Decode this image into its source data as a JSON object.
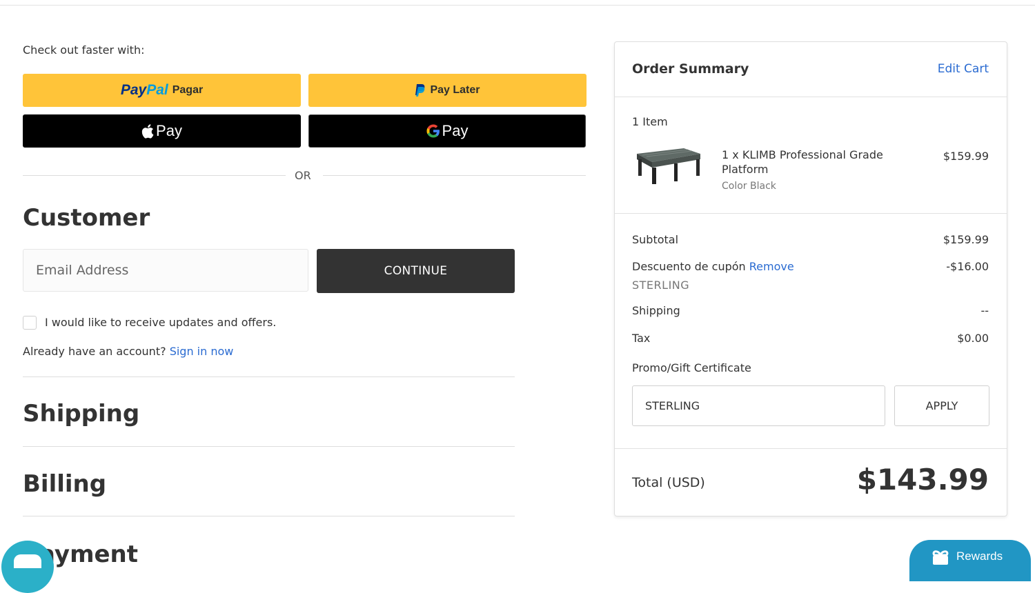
{
  "express": {
    "heading": "Check out faster with:",
    "paypal_word_1": "Pay",
    "paypal_word_2": "Pal",
    "paypal_sub": "Pagar",
    "paylater_label": "Pay Later",
    "applepay_label": "Pay",
    "googlepay_label": "Pay",
    "or_label": "OR"
  },
  "customer": {
    "title": "Customer",
    "email_placeholder": "Email Address",
    "continue_label": "CONTINUE",
    "updates_label": "I would like to receive updates and offers.",
    "account_prompt": "Already have an account?",
    "sign_in_label": "Sign in now"
  },
  "sections": {
    "shipping": "Shipping",
    "billing": "Billing",
    "payment": "Payment"
  },
  "summary": {
    "title": "Order Summary",
    "edit_cart": "Edit Cart",
    "item_count": "1 Item",
    "product": {
      "name": "1 x KLIMB Professional Grade Platform",
      "option": "Color Black",
      "price": "$159.99"
    },
    "subtotal_label": "Subtotal",
    "subtotal_value": "$159.99",
    "discount_label": "Descuento de cupón",
    "discount_remove": "Remove",
    "discount_value": "-$16.00",
    "coupon_code": "STERLING",
    "shipping_label": "Shipping",
    "shipping_value": "--",
    "tax_label": "Tax",
    "tax_value": "$0.00",
    "promo_label": "Promo/Gift Certificate",
    "promo_value": "STERLING",
    "apply_label": "APPLY",
    "total_label": "Total (USD)",
    "total_value": "$143.99"
  },
  "widgets": {
    "rewards_label": "Rewards"
  },
  "colors": {
    "link": "#2a6bd1",
    "paypal_yellow": "#ffc439",
    "continue_bg": "#333333",
    "rewards_bg": "#2196c4"
  }
}
